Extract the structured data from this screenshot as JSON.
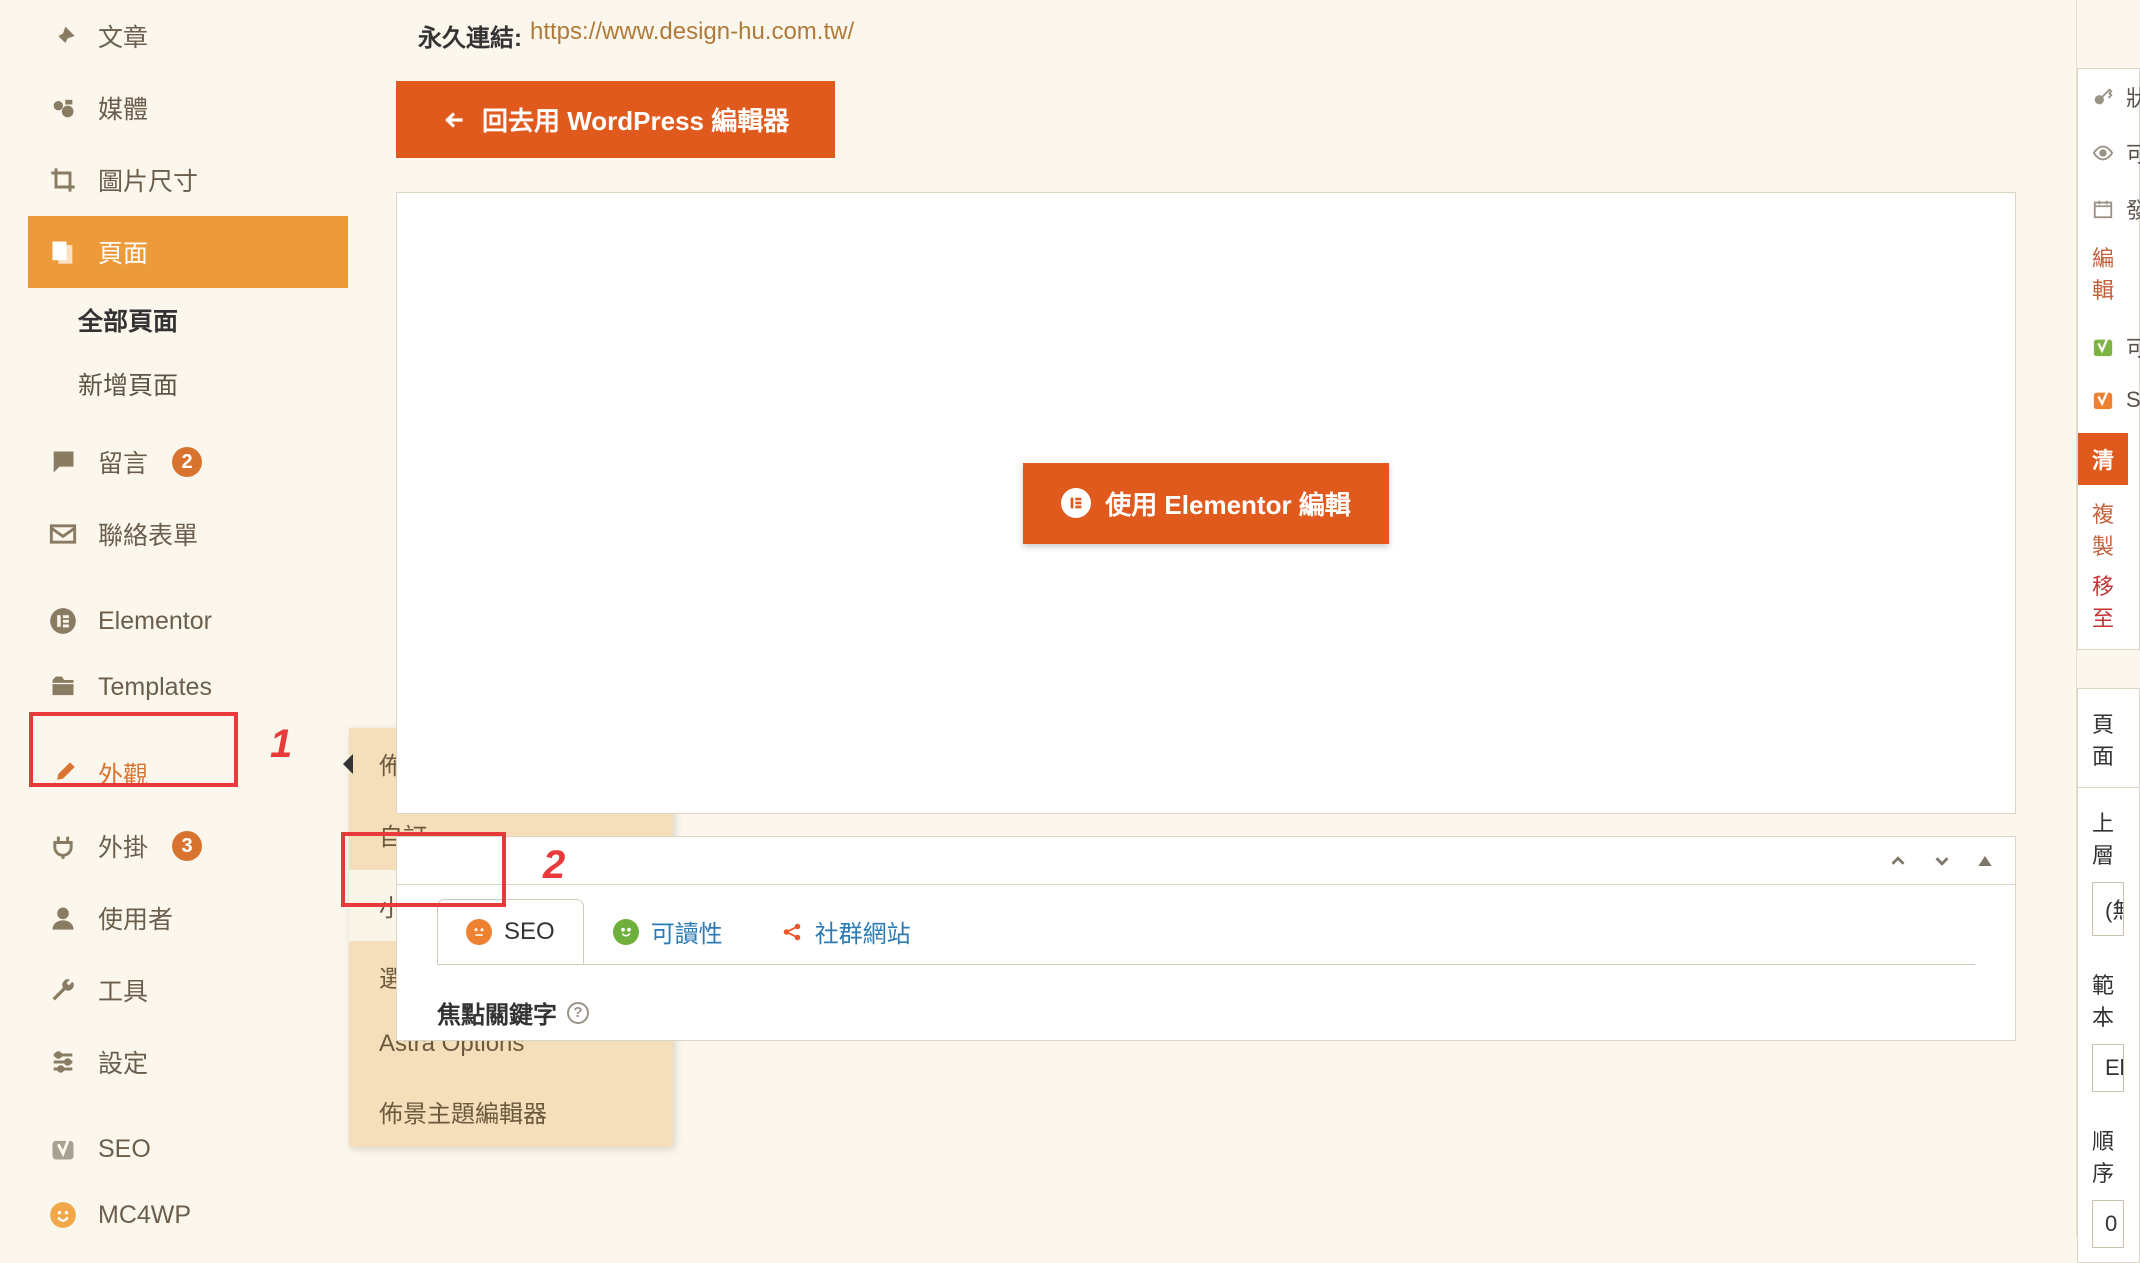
{
  "sidebar": {
    "items": [
      {
        "label": "文章",
        "icon": "pin"
      },
      {
        "label": "媒體",
        "icon": "camera"
      },
      {
        "label": "圖片尺寸",
        "icon": "crop"
      },
      {
        "label": "頁面",
        "icon": "pages"
      },
      {
        "label": "留言",
        "icon": "comment",
        "badge": "2"
      },
      {
        "label": "聯絡表單",
        "icon": "mail"
      },
      {
        "label": "Elementor",
        "icon": "elementor"
      },
      {
        "label": "Templates",
        "icon": "folder"
      },
      {
        "label": "外觀",
        "icon": "brush"
      },
      {
        "label": "外掛",
        "icon": "plug",
        "badge": "3"
      },
      {
        "label": "使用者",
        "icon": "user"
      },
      {
        "label": "工具",
        "icon": "wrench"
      },
      {
        "label": "設定",
        "icon": "sliders"
      },
      {
        "label": "SEO",
        "icon": "yoast"
      },
      {
        "label": "MC4WP",
        "icon": "mailchimp"
      }
    ],
    "pages_submenu": [
      "全部頁面",
      "新增頁面"
    ]
  },
  "flyout": {
    "items": [
      "佈景主題",
      "自訂",
      "小工具",
      "選單",
      "Astra Options",
      "佈景主題編輯器"
    ]
  },
  "annotations": {
    "label1": "1",
    "label2": "2"
  },
  "main": {
    "permalink_label": "永久連結:",
    "permalink_url": "https://www.design-hu.com.tw/",
    "back_button": "回去用 WordPress 編輯器",
    "elementor_button": "使用 Elementor 編輯"
  },
  "seo": {
    "tabs": [
      "SEO",
      "可讀性",
      "社群網站"
    ],
    "focus_keyword_label": "焦點關鍵字"
  },
  "rightRail": {
    "status_icon": "key",
    "visibility_icon": "eye",
    "date_icon": "calendar",
    "edit_link": "編輯",
    "yoast1": "yoast",
    "yoast2": "yoast-s",
    "clear_btn": "清",
    "copy_link": "複製",
    "move_link": "移至",
    "panel2_title": "頁面",
    "parent_label": "上層",
    "parent_value": "(無",
    "template_label": "範本",
    "template_value": "Ele",
    "order_label": "順序",
    "order_value": "0"
  }
}
